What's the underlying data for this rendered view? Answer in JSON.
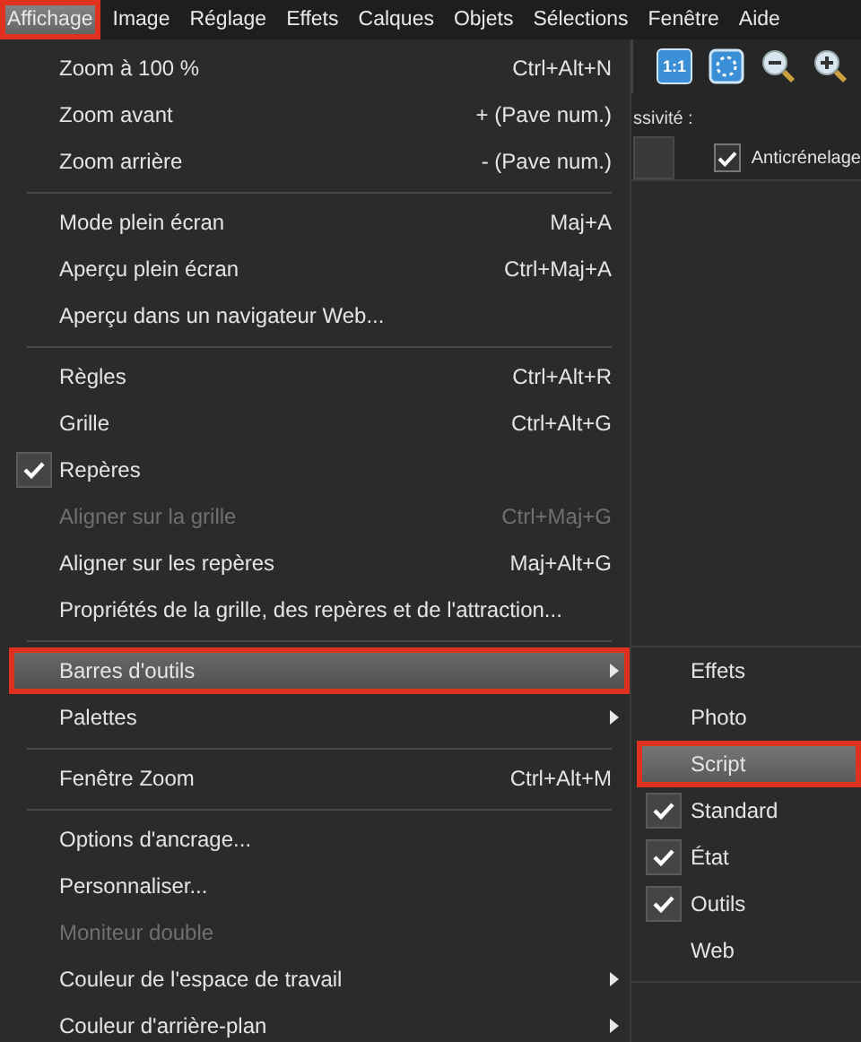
{
  "menubar": [
    {
      "label": "Affichage",
      "selected": true,
      "annotated": true
    },
    {
      "label": "Image",
      "selected": false,
      "annotated": false
    },
    {
      "label": "Réglage",
      "selected": false,
      "annotated": false
    },
    {
      "label": "Effets",
      "selected": false,
      "annotated": false
    },
    {
      "label": "Calques",
      "selected": false,
      "annotated": false
    },
    {
      "label": "Objets",
      "selected": false,
      "annotated": false
    },
    {
      "label": "Sélections",
      "selected": false,
      "annotated": false
    },
    {
      "label": "Fenêtre",
      "selected": false,
      "annotated": false
    },
    {
      "label": "Aide",
      "selected": false,
      "annotated": false
    }
  ],
  "menu": {
    "sections": [
      [
        {
          "label": "Zoom à 100 %",
          "shortcut": "Ctrl+Alt+N",
          "checked": false,
          "disabled": false,
          "submenu": false,
          "selected": false,
          "annotated": false
        },
        {
          "label": "Zoom avant",
          "shortcut": "+ (Pave num.)",
          "checked": false,
          "disabled": false,
          "submenu": false,
          "selected": false,
          "annotated": false
        },
        {
          "label": "Zoom arrière",
          "shortcut": "- (Pave num.)",
          "checked": false,
          "disabled": false,
          "submenu": false,
          "selected": false,
          "annotated": false
        }
      ],
      [
        {
          "label": "Mode plein écran",
          "shortcut": "Maj+A",
          "checked": false,
          "disabled": false,
          "submenu": false,
          "selected": false,
          "annotated": false
        },
        {
          "label": "Aperçu plein écran",
          "shortcut": "Ctrl+Maj+A",
          "checked": false,
          "disabled": false,
          "submenu": false,
          "selected": false,
          "annotated": false
        },
        {
          "label": "Aperçu dans un navigateur Web...",
          "checked": false,
          "disabled": false,
          "submenu": false,
          "selected": false,
          "annotated": false
        }
      ],
      [
        {
          "label": "Règles",
          "shortcut": "Ctrl+Alt+R",
          "checked": false,
          "disabled": false,
          "submenu": false,
          "selected": false,
          "annotated": false
        },
        {
          "label": "Grille",
          "shortcut": "Ctrl+Alt+G",
          "checked": false,
          "disabled": false,
          "submenu": false,
          "selected": false,
          "annotated": false
        },
        {
          "label": "Repères",
          "checked": true,
          "disabled": false,
          "submenu": false,
          "selected": false,
          "annotated": false
        },
        {
          "label": "Aligner sur la grille",
          "shortcut": "Ctrl+Maj+G",
          "checked": false,
          "disabled": true,
          "submenu": false,
          "selected": false,
          "annotated": false
        },
        {
          "label": "Aligner sur les repères",
          "shortcut": "Maj+Alt+G",
          "checked": false,
          "disabled": false,
          "submenu": false,
          "selected": false,
          "annotated": false
        },
        {
          "label": "Propriétés de la grille, des repères et de l'attraction...",
          "checked": false,
          "disabled": false,
          "submenu": false,
          "selected": false,
          "annotated": false
        }
      ],
      [
        {
          "label": "Barres d'outils",
          "checked": false,
          "disabled": false,
          "submenu": true,
          "selected": true,
          "annotated": true
        },
        {
          "label": "Palettes",
          "checked": false,
          "disabled": false,
          "submenu": true,
          "selected": false,
          "annotated": false
        }
      ],
      [
        {
          "label": "Fenêtre Zoom",
          "shortcut": "Ctrl+Alt+M",
          "checked": false,
          "disabled": false,
          "submenu": false,
          "selected": false,
          "annotated": false
        }
      ],
      [
        {
          "label": "Options d'ancrage...",
          "checked": false,
          "disabled": false,
          "submenu": false,
          "selected": false,
          "annotated": false
        },
        {
          "label": "Personnaliser...",
          "checked": false,
          "disabled": false,
          "submenu": false,
          "selected": false,
          "annotated": false
        },
        {
          "label": "Moniteur double",
          "checked": false,
          "disabled": true,
          "submenu": false,
          "selected": false,
          "annotated": false
        },
        {
          "label": "Couleur de l'espace de travail",
          "checked": false,
          "disabled": false,
          "submenu": true,
          "selected": false,
          "annotated": false
        },
        {
          "label": "Couleur d'arrière-plan",
          "checked": false,
          "disabled": false,
          "submenu": true,
          "selected": false,
          "annotated": false
        }
      ]
    ]
  },
  "toolbar": {
    "buttons": [
      {
        "kind": "actual-size",
        "label": "1:1"
      },
      {
        "kind": "fit"
      },
      {
        "kind": "zoom-out"
      },
      {
        "kind": "zoom-in"
      }
    ]
  },
  "options": {
    "label": "ssivité :",
    "checkbox": {
      "label": "Anticrénelage",
      "checked": true
    }
  },
  "submenu": {
    "items": [
      {
        "label": "Effets",
        "checked": false,
        "selected": false,
        "annotated": false
      },
      {
        "label": "Photo",
        "checked": false,
        "selected": false,
        "annotated": false
      },
      {
        "label": "Script",
        "checked": false,
        "selected": true,
        "annotated": true
      },
      {
        "label": "Standard",
        "checked": true,
        "selected": false,
        "annotated": false
      },
      {
        "label": "État",
        "checked": true,
        "selected": false,
        "annotated": false
      },
      {
        "label": "Outils",
        "checked": true,
        "selected": false,
        "annotated": false
      },
      {
        "label": "Web",
        "checked": false,
        "selected": false,
        "annotated": false
      }
    ]
  }
}
